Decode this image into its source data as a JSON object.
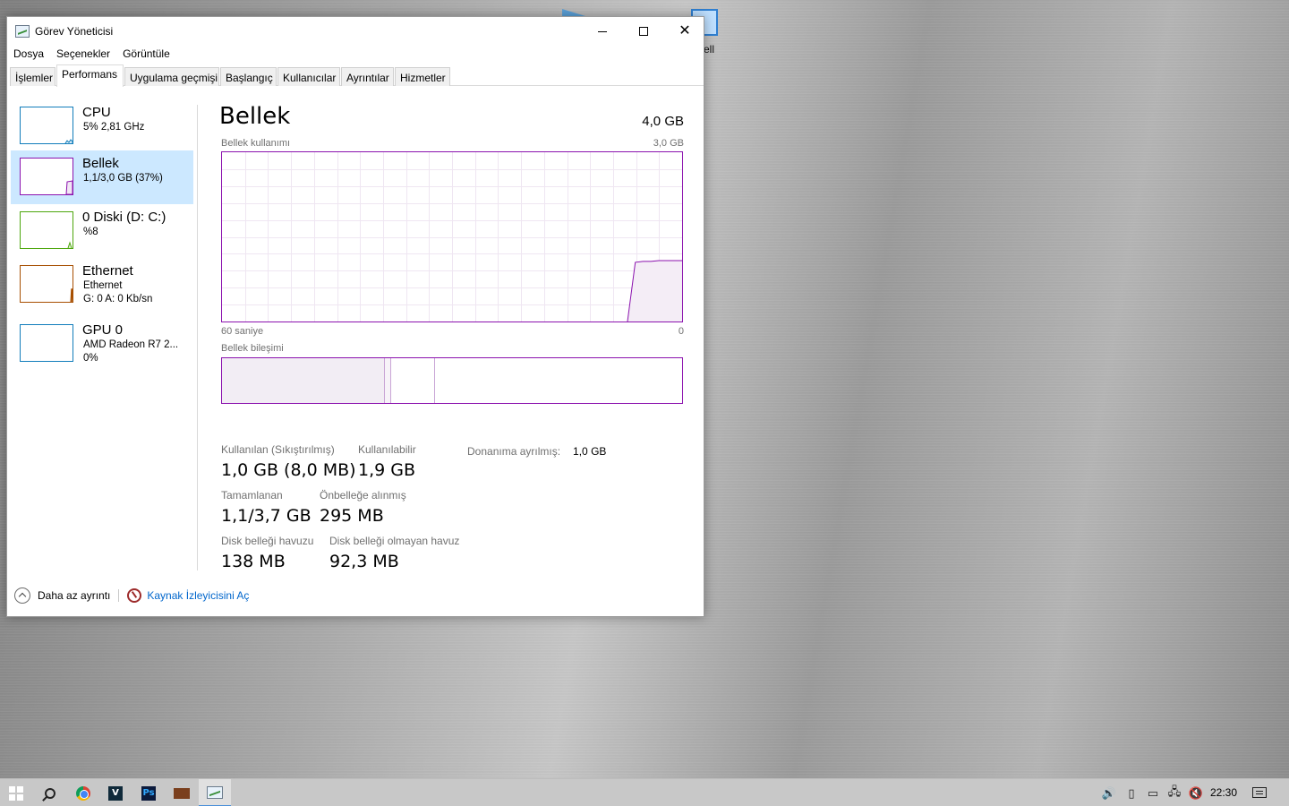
{
  "window": {
    "title": "Görev Yöneticisi"
  },
  "menu": [
    "Dosya",
    "Seçenekler",
    "Görüntüle"
  ],
  "tabs": [
    "İşlemler",
    "Performans",
    "Uygulama geçmişi",
    "Başlangıç",
    "Kullanıcılar",
    "Ayrıntılar",
    "Hizmetler"
  ],
  "active_tab": "Performans",
  "sidebar": [
    {
      "name": "CPU",
      "sub1": "5% 2,81 GHz",
      "sub2": "",
      "color": "#117dbb",
      "icon": "cpu-graph-icon"
    },
    {
      "name": "Bellek",
      "sub1": "1,1/3,0 GB (37%)",
      "sub2": "",
      "color": "#8b12ae",
      "icon": "memory-graph-icon"
    },
    {
      "name": "0 Diski (D: C:)",
      "sub1": "%8",
      "sub2": "",
      "color": "#4da60c",
      "icon": "disk-graph-icon"
    },
    {
      "name": "Ethernet",
      "sub1": "Ethernet",
      "sub2": "G: 0 A: 0 Kb/sn",
      "color": "#a74f01",
      "icon": "ethernet-graph-icon"
    },
    {
      "name": "GPU 0",
      "sub1": "AMD Radeon R7 2...",
      "sub2": "0%",
      "color": "#117dbb",
      "icon": "gpu-graph-icon"
    }
  ],
  "detail": {
    "title": "Bellek",
    "capacity": "4,0 GB",
    "usage_label": "Bellek kullanımı",
    "usage_max": "3,0 GB",
    "time_left": "60 saniye",
    "time_right": "0",
    "composition_label": "Bellek bileşimi",
    "stats": {
      "in_use_label": "Kullanılan (Sıkıştırılmış)",
      "in_use_value": "1,0 GB (8,0 MB)",
      "available_label": "Kullanılabilir",
      "available_value": "1,9 GB",
      "hw_reserved_label": "Donanıma ayrılmış:",
      "hw_reserved_value": "1,0 GB",
      "committed_label": "Tamamlanan",
      "committed_value": "1,1/3,7 GB",
      "cached_label": "Önbelleğe alınmış",
      "cached_value": "295 MB",
      "paged_label": "Disk belleği havuzu",
      "paged_value": "138 MB",
      "nonpaged_label": "Disk belleği olmayan havuz",
      "nonpaged_value": "92,3 MB"
    },
    "composition_fractions": {
      "in_use": 0.355,
      "modified": 0.013,
      "standby": 0.095
    },
    "usage_history_fraction": [
      0,
      0,
      0,
      0,
      0,
      0,
      0,
      0,
      0,
      0,
      0,
      0,
      0,
      0,
      0,
      0,
      0,
      0,
      0,
      0,
      0,
      0,
      0,
      0,
      0,
      0,
      0,
      0,
      0,
      0,
      0,
      0,
      0,
      0,
      0,
      0,
      0,
      0,
      0,
      0,
      0,
      0,
      0,
      0,
      0,
      0,
      0,
      0,
      0,
      0,
      0,
      0,
      0,
      0.35,
      0.355,
      0.355,
      0.36,
      0.36,
      0.36,
      0.36
    ]
  },
  "footer": {
    "fewer_details": "Daha az ayrıntı",
    "resource_monitor": "Kaynak İzleyicisini Aç"
  },
  "desktop_icon_label": "ell",
  "taskbar": {
    "clock": "22:30",
    "apps": [
      "start",
      "search",
      "chrome",
      "vim",
      "photoshop",
      "winrar",
      "task-manager"
    ]
  }
}
